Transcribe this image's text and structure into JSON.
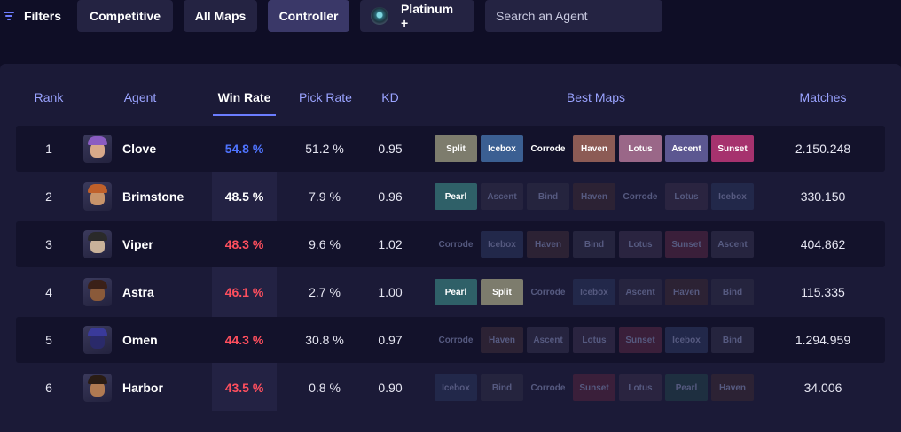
{
  "filters": {
    "label": "Filters",
    "buttons": [
      {
        "label": "Competitive",
        "active": false
      },
      {
        "label": "All Maps",
        "active": false
      },
      {
        "label": "Controller",
        "active": true
      },
      {
        "label": "Platinum +",
        "active": false,
        "icon": "platinum-rank-icon"
      }
    ],
    "search_placeholder": "Search an Agent"
  },
  "table": {
    "headers": {
      "rank": "Rank",
      "agent": "Agent",
      "win_rate": "Win Rate",
      "pick_rate": "Pick Rate",
      "kd": "KD",
      "best_maps": "Best Maps",
      "matches": "Matches"
    },
    "active_sort": "win_rate",
    "rows": [
      {
        "rank": "1",
        "agent": "Clove",
        "win_rate": "54.8 %",
        "pick_rate": "51.2 %",
        "kd": "0.95",
        "matches": "2.150.248",
        "avatar": {
          "hair": "#8a5cc2",
          "skin": "#d8a98a"
        },
        "maps": [
          {
            "name": "Split",
            "strong": true
          },
          {
            "name": "Icebox",
            "strong": true
          },
          {
            "name": "Corrode",
            "strong": true
          },
          {
            "name": "Haven",
            "strong": true
          },
          {
            "name": "Lotus",
            "strong": true
          },
          {
            "name": "Ascent",
            "strong": true
          },
          {
            "name": "Sunset",
            "strong": true
          }
        ]
      },
      {
        "rank": "2",
        "agent": "Brimstone",
        "win_rate": "48.5 %",
        "pick_rate": "7.9 %",
        "kd": "0.96",
        "matches": "330.150",
        "avatar": {
          "hair": "#c0602a",
          "skin": "#c8946a"
        },
        "maps": [
          {
            "name": "Pearl",
            "strong": true
          },
          {
            "name": "Ascent",
            "strong": false
          },
          {
            "name": "Bind",
            "strong": false
          },
          {
            "name": "Haven",
            "strong": false
          },
          {
            "name": "Corrode",
            "strong": false
          },
          {
            "name": "Lotus",
            "strong": false
          },
          {
            "name": "Icebox",
            "strong": false
          }
        ]
      },
      {
        "rank": "3",
        "agent": "Viper",
        "win_rate": "48.3 %",
        "pick_rate": "9.6 %",
        "kd": "1.02",
        "matches": "404.862",
        "avatar": {
          "hair": "#2a2a2a",
          "skin": "#c9b29a"
        },
        "maps": [
          {
            "name": "Corrode",
            "strong": false
          },
          {
            "name": "Icebox",
            "strong": false
          },
          {
            "name": "Haven",
            "strong": false
          },
          {
            "name": "Bind",
            "strong": false
          },
          {
            "name": "Lotus",
            "strong": false
          },
          {
            "name": "Sunset",
            "strong": false
          },
          {
            "name": "Ascent",
            "strong": false
          }
        ]
      },
      {
        "rank": "4",
        "agent": "Astra",
        "win_rate": "46.1 %",
        "pick_rate": "2.7 %",
        "kd": "1.00",
        "matches": "115.335",
        "avatar": {
          "hair": "#3a2018",
          "skin": "#8a5a3a"
        },
        "maps": [
          {
            "name": "Pearl",
            "strong": true
          },
          {
            "name": "Split",
            "strong": true
          },
          {
            "name": "Corrode",
            "strong": false
          },
          {
            "name": "Icebox",
            "strong": false
          },
          {
            "name": "Ascent",
            "strong": false
          },
          {
            "name": "Haven",
            "strong": false
          },
          {
            "name": "Bind",
            "strong": false
          }
        ]
      },
      {
        "rank": "5",
        "agent": "Omen",
        "win_rate": "44.3 %",
        "pick_rate": "30.8 %",
        "kd": "0.97",
        "matches": "1.294.959",
        "avatar": {
          "hair": "#3a3a9a",
          "skin": "#2a2a6a"
        },
        "maps": [
          {
            "name": "Corrode",
            "strong": false
          },
          {
            "name": "Haven",
            "strong": false
          },
          {
            "name": "Ascent",
            "strong": false
          },
          {
            "name": "Lotus",
            "strong": false
          },
          {
            "name": "Sunset",
            "strong": false
          },
          {
            "name": "Icebox",
            "strong": false
          },
          {
            "name": "Bind",
            "strong": false
          }
        ]
      },
      {
        "rank": "6",
        "agent": "Harbor",
        "win_rate": "43.5 %",
        "pick_rate": "0.8 %",
        "kd": "0.90",
        "matches": "34.006",
        "avatar": {
          "hair": "#2a1c14",
          "skin": "#b07a52"
        },
        "maps": [
          {
            "name": "Icebox",
            "strong": false
          },
          {
            "name": "Bind",
            "strong": false
          },
          {
            "name": "Corrode",
            "strong": false
          },
          {
            "name": "Sunset",
            "strong": false
          },
          {
            "name": "Lotus",
            "strong": false
          },
          {
            "name": "Pearl",
            "strong": false
          },
          {
            "name": "Haven",
            "strong": false
          }
        ]
      }
    ]
  },
  "colors": {
    "win_high": "#4f74ff",
    "win_mid": "#ffffff",
    "win_low": "#ff4f5e",
    "map_strong": {
      "Split": "#7d7c6d",
      "Icebox": "#3b5f92",
      "Corrode": "transparent",
      "Haven": "#8c5b55",
      "Lotus": "#9a6788",
      "Ascent": "#5c5791",
      "Sunset": "#a6326e",
      "Pearl": "#2f6068",
      "Bind": "#3a3a55"
    },
    "map_dim": {
      "Split": "#2e2e3e",
      "Icebox": "#22284a",
      "Corrode": "transparent",
      "Haven": "#2c2234",
      "Lotus": "#2a2440",
      "Ascent": "#26243f",
      "Sunset": "#3a1f3a",
      "Pearl": "#1e2f40",
      "Bind": "#25243e"
    }
  }
}
